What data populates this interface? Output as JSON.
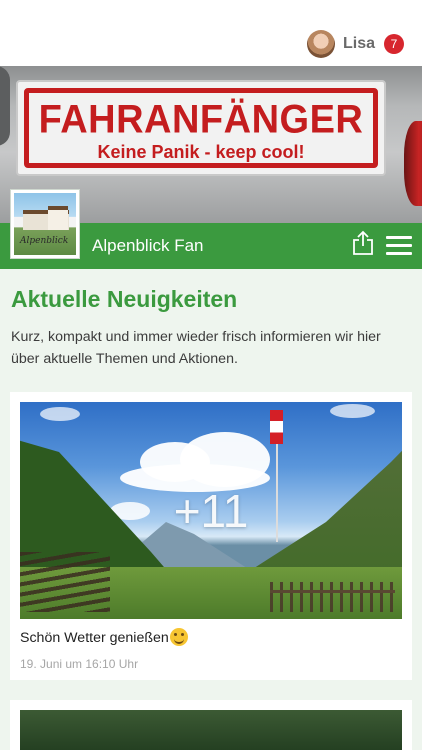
{
  "header": {
    "user_name": "Lisa",
    "notification_count": "7"
  },
  "hero": {
    "sign_title": "FAHRANFÄNGER",
    "sign_subtitle": "Keine Panik - keep cool!"
  },
  "brand": {
    "name": "Alpenblick Fan",
    "logo_script": "Alpenblick"
  },
  "section": {
    "title": "Aktuelle Neuigkeiten",
    "description": "Kurz, kompakt und immer wieder frisch informieren wir hier über aktuelle Themen und Aktionen."
  },
  "posts": [
    {
      "photo_count": "+11",
      "caption": "Schön Wetter genießen",
      "date": "19. Juni um 16:10 Uhr"
    }
  ],
  "colors": {
    "brand_green": "#3b9a3f",
    "badge_red": "#d7262e",
    "background": "#eef5ee"
  },
  "icons": {
    "share": "share-icon",
    "menu": "hamburger-menu-icon",
    "emoji": "smiling-face-icon"
  }
}
